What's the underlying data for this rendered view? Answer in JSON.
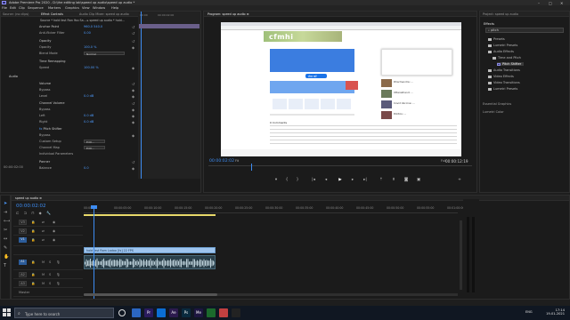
{
  "app": {
    "title": "Adobe Premiere Pro 2020 - D:\\the editing lab\\speed up audio\\speed up audio *",
    "menu": [
      "File",
      "Edit",
      "Clip",
      "Sequence",
      "Markers",
      "Graphics",
      "View",
      "Window",
      "Help"
    ],
    "window_controls": [
      "–",
      "□",
      "✕"
    ]
  },
  "effect_controls": {
    "tabs": [
      "Source: (no clips)",
      "Effect Controls",
      "Audio Clip Mixer: speed up audio",
      "Metadata"
    ],
    "source_line": "Source * hold fast Ran Yoo Sa...  ▸  speed up audio * hold...",
    "rows": [
      {
        "label": "Anchor Point",
        "value": "960.0   540.0"
      },
      {
        "label": "Anti-flicker Filter",
        "value": "0.00"
      },
      {
        "label": "Opacity",
        "value": ""
      },
      {
        "label": "Opacity",
        "value": "100.0 %"
      },
      {
        "label": "Blend Mode",
        "value": "Normal"
      },
      {
        "label": "Time Remapping",
        "value": ""
      },
      {
        "label": "Speed",
        "value": "100.00 %"
      },
      {
        "label": "Audio",
        "value": ""
      },
      {
        "label": "Volume",
        "value": ""
      },
      {
        "label": "Bypass",
        "value": ""
      },
      {
        "label": "Level",
        "value": "0.0 dB"
      },
      {
        "label": "Channel Volume",
        "value": ""
      },
      {
        "label": "Bypass",
        "value": ""
      },
      {
        "label": "Left",
        "value": "0.0 dB"
      },
      {
        "label": "Right",
        "value": "0.0 dB"
      },
      {
        "label": "Pitch Shifter",
        "value": "Edit..."
      },
      {
        "label": "Bypass",
        "value": ""
      },
      {
        "label": "Custom Setup",
        "value": "Edit..."
      },
      {
        "label": "Channel Map",
        "value": ""
      },
      {
        "label": "Individual Parameters",
        "value": ""
      },
      {
        "label": "Panner",
        "value": ""
      },
      {
        "label": "Balance",
        "value": "0.0"
      }
    ],
    "timecode": "00:00:02:00",
    "ruler": [
      "00:00",
      "00:00:02:00"
    ]
  },
  "program": {
    "title": "Program: speed up audio  ≡",
    "timecode_left": "00:00:02:02",
    "fit": "Fit",
    "full": "Full",
    "timecode_right": "00:00:12:19",
    "webpage": {
      "logo": "cfmhi",
      "comment_title": "0 Comments",
      "sort": "Sort by Newest",
      "share_button": "शेयर करें",
      "news_items": [
        "Dharmendra: ...",
        "Uttarakhand: ...",
        "Covid Vaccine: ...",
        "Politics: ...",
        "Sports: ..."
      ]
    }
  },
  "project": {
    "tabs": [
      "Project: speed up audio",
      "Effects",
      "Essential Graphics",
      "Lumetri Color"
    ],
    "search": "pitch",
    "tree": [
      {
        "label": "Presets",
        "selected": false
      },
      {
        "label": "Lumetri Presets",
        "selected": false
      },
      {
        "label": "Audio Effects",
        "selected": false
      },
      {
        "label": "Time and Pitch",
        "selected": false
      },
      {
        "label": "Pitch Shifter",
        "selected": true
      },
      {
        "label": "Audio Transitions",
        "selected": false
      },
      {
        "label": "Video Effects",
        "selected": false
      },
      {
        "label": "Video Transitions",
        "selected": false
      },
      {
        "label": "Lumetri Presets",
        "selected": false
      }
    ],
    "extra_tabs": [
      "Essential Graphics",
      "Lumetri Color"
    ]
  },
  "timeline": {
    "tab": "speed up audio  ≡",
    "timecode": "00:00:02:02",
    "ruler": [
      "00:00",
      "00:00:05:00",
      "00:00:10:00",
      "00:00:15:00",
      "00:00:20:00",
      "00:00:25:00",
      "00:00:30:00",
      "00:00:35:00",
      "00:00:40:00",
      "00:00:45:00",
      "00:00:50:00",
      "00:00:55:00",
      "00:01:00:00"
    ],
    "tracks": [
      {
        "name": "V3",
        "on": false
      },
      {
        "name": "V2",
        "on": false
      },
      {
        "name": "V1",
        "on": true
      },
      {
        "name": "A1",
        "on": true
      },
      {
        "name": "A2",
        "on": false
      },
      {
        "name": "A3",
        "on": false
      },
      {
        "name": "Master",
        "on": false
      }
    ],
    "video_clip": "hold fast Ram Ladoo [fx] 22 FPS",
    "audio_label": "Audio 1"
  },
  "taskbar": {
    "search_placeholder": "Type here to search",
    "apps": [
      {
        "label": "",
        "color": "#2b66c2",
        "icon": "file-explorer-icon"
      },
      {
        "label": "Pr",
        "color": "#2a1b5e",
        "icon": "premiere-icon"
      },
      {
        "label": "",
        "color": "#0b6ed4",
        "icon": "edge-icon"
      },
      {
        "label": "Ae",
        "color": "#2c1b4e",
        "icon": "after-effects-icon"
      },
      {
        "label": "Ps",
        "color": "#0a2a3e",
        "icon": "photoshop-icon"
      },
      {
        "label": "Me",
        "color": "#1d1640",
        "icon": "media-encoder-icon"
      },
      {
        "label": "",
        "color": "#1b6a2c",
        "icon": "app-green-icon"
      },
      {
        "label": "",
        "color": "#c24040",
        "icon": "chrome-icon"
      },
      {
        "label": "",
        "color": "#222222",
        "icon": "obs-icon"
      }
    ],
    "lang": "ENG",
    "time": "17:14",
    "date": "19-01-2021"
  },
  "colors": {
    "accent": "#3d8cf2",
    "workarea": "#e8d96a",
    "video_clip": "#9ec4ee",
    "audio_clip": "#2a3f4a"
  }
}
